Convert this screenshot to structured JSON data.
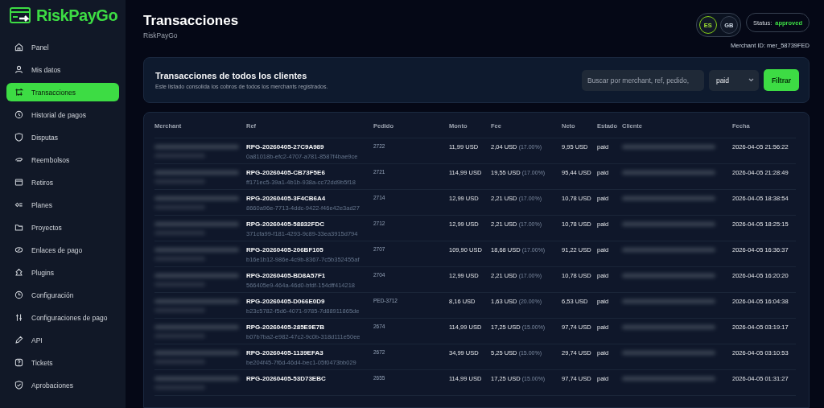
{
  "sidebar": {
    "brand": "RiskPayGo",
    "items": [
      {
        "label": "Panel",
        "selected": false
      },
      {
        "label": "Mis datos",
        "selected": false
      },
      {
        "label": "Transacciones",
        "selected": true
      },
      {
        "label": "Historial de pagos",
        "selected": false
      },
      {
        "label": "Disputas",
        "selected": false
      },
      {
        "label": "Reembolsos",
        "selected": false
      },
      {
        "label": "Retiros",
        "selected": false
      },
      {
        "label": "Planes",
        "selected": false
      },
      {
        "label": "Proyectos",
        "selected": false
      },
      {
        "label": "Enlaces de pago",
        "selected": false
      },
      {
        "label": "Plugins",
        "selected": false
      },
      {
        "label": "Configuración",
        "selected": false
      },
      {
        "label": "Configuraciones de pago",
        "selected": false
      },
      {
        "label": "API",
        "selected": false
      },
      {
        "label": "Tickets",
        "selected": false
      },
      {
        "label": "Aprobaciones",
        "selected": false
      }
    ]
  },
  "header": {
    "title": "Transacciones",
    "subtitle": "RiskPayGo",
    "languages": [
      {
        "label": "ES",
        "selected": true
      },
      {
        "label": "GB",
        "selected": false
      }
    ],
    "status_label": "Status:",
    "status_value": "approved",
    "merchant_id": "Merchant ID: mer_58739FED"
  },
  "filter_card": {
    "title": "Transacciones de todos los clientes",
    "description": "Este listado consolida los cobros de todos los merchants registrados.",
    "search_placeholder": "Buscar por merchant, ref, pedido,",
    "status_value": "paid",
    "button": "Filtrar"
  },
  "table": {
    "columns": [
      "Merchant",
      "Ref",
      "Pedido",
      "Monto",
      "Fee",
      "Neto",
      "Estado",
      "Cliente",
      "Fecha"
    ],
    "rows": [
      {
        "ref": "RPG-20260405-27C9A989",
        "uuid": "0a81018b-efc2-4707-a781-8587f4bae9ce",
        "pedido": "2722",
        "monto": "11,99 USD",
        "fee": "2,04 USD",
        "fee_pct": "(17.00%)",
        "neto": "9,95 USD",
        "estado": "paid",
        "fecha": "2026-04-05 21:56:22"
      },
      {
        "ref": "RPG-20260405-CB73F5E6",
        "uuid": "ff171ec5-39a1-4b1b-938a-cc72dd9b5f18",
        "pedido": "2721",
        "monto": "114,99 USD",
        "fee": "19,55 USD",
        "fee_pct": "(17.00%)",
        "neto": "95,44 USD",
        "estado": "paid",
        "fecha": "2026-04-05 21:28:49"
      },
      {
        "ref": "RPG-20260405-3F4CB6A4",
        "uuid": "8660a96e-7713-4ddc-9422-f46e42e3ad27",
        "pedido": "2714",
        "monto": "12,99 USD",
        "fee": "2,21 USD",
        "fee_pct": "(17.00%)",
        "neto": "10,78 USD",
        "estado": "paid",
        "fecha": "2026-04-05 18:38:54"
      },
      {
        "ref": "RPG-20260405-58832FDC",
        "uuid": "371cfa99-f181-4293-9c89-33ea3915d794",
        "pedido": "2712",
        "monto": "12,99 USD",
        "fee": "2,21 USD",
        "fee_pct": "(17.00%)",
        "neto": "10,78 USD",
        "estado": "paid",
        "fecha": "2026-04-05 18:25:15"
      },
      {
        "ref": "RPG-20260405-206BF105",
        "uuid": "b16e1b12-986e-4c9b-8367-7c5b352455af",
        "pedido": "2707",
        "monto": "109,90 USD",
        "fee": "18,68 USD",
        "fee_pct": "(17.00%)",
        "neto": "91,22 USD",
        "estado": "paid",
        "fecha": "2026-04-05 16:36:37"
      },
      {
        "ref": "RPG-20260405-BD8A57F1",
        "uuid": "566405e9-464a-46d0-bfdf-154dff414218",
        "pedido": "2704",
        "monto": "12,99 USD",
        "fee": "2,21 USD",
        "fee_pct": "(17.00%)",
        "neto": "10,78 USD",
        "estado": "paid",
        "fecha": "2026-04-05 16:20:20"
      },
      {
        "ref": "RPG-20260405-D066E0D9",
        "uuid": "b23c5782-f5d6-4071-9785-7d88911865de",
        "pedido": "PED-3712",
        "monto": "8,16 USD",
        "fee": "1,63 USD",
        "fee_pct": "(20.00%)",
        "neto": "6,53 USD",
        "estado": "paid",
        "fecha": "2026-04-05 16:04:38"
      },
      {
        "ref": "RPG-20260405-285E9E7B",
        "uuid": "b07b7ba2-e982-47c2-9c0b-318d111e50ee",
        "pedido": "2674",
        "monto": "114,99 USD",
        "fee": "17,25 USD",
        "fee_pct": "(15.00%)",
        "neto": "97,74 USD",
        "estado": "paid",
        "fecha": "2026-04-05 03:19:17"
      },
      {
        "ref": "RPG-20260405-1139EFA3",
        "uuid": "be204f45-7f6d-46d4-bec1-05f0473bb029",
        "pedido": "2672",
        "monto": "34,99 USD",
        "fee": "5,25 USD",
        "fee_pct": "(15.00%)",
        "neto": "29,74 USD",
        "estado": "paid",
        "fecha": "2026-04-05 03:10:53"
      },
      {
        "ref": "RPG-20260405-53D73EBC",
        "pedido": "2655",
        "monto": "114,99 USD",
        "fee": "17,25 USD",
        "fee_pct": "(15.00%)",
        "neto": "97,74 USD",
        "estado": "paid",
        "fecha": "2026-04-05 01:31:27"
      }
    ]
  }
}
